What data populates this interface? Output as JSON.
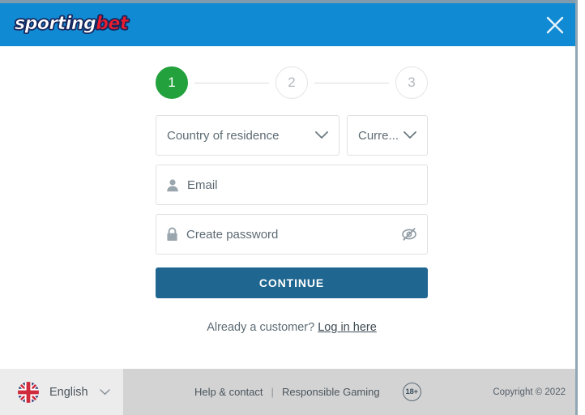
{
  "header": {
    "logo_part_a": "sporting",
    "logo_part_b": "bet",
    "logo_color_white": "#ffffff",
    "logo_color_red": "#ec1c2e",
    "background_color": "#118ad4",
    "close_label": "close-icon"
  },
  "stepper": {
    "steps": [
      {
        "number": "1",
        "state": "active"
      },
      {
        "number": "2",
        "state": "idle"
      },
      {
        "number": "3",
        "state": "idle"
      }
    ],
    "active_color": "#22a13c",
    "idle_color": "#b3b8bd"
  },
  "form": {
    "country_select": {
      "value": "Country of residence",
      "placeholder": "Country of residence"
    },
    "currency_select": {
      "value": "Curre...",
      "placeholder": "Currency"
    },
    "email_field": {
      "value": "",
      "placeholder": "Email",
      "icon": "user-icon"
    },
    "password_field": {
      "value": "",
      "placeholder": "Create password",
      "icon": "lock-icon",
      "toggle_icon": "eye-off-icon"
    },
    "continue_label": "CONTINUE",
    "continue_color": "#1f6690",
    "login_prompt": "Already a customer?",
    "login_link": "Log in here"
  },
  "footer": {
    "language": {
      "label": "English",
      "flag": "uk-flag-icon"
    },
    "links": [
      {
        "label": "Help & contact"
      },
      {
        "label": "Responsible Gaming"
      }
    ],
    "separator": "|",
    "age_badge": "18+",
    "copyright": "Copyright © 2022"
  }
}
